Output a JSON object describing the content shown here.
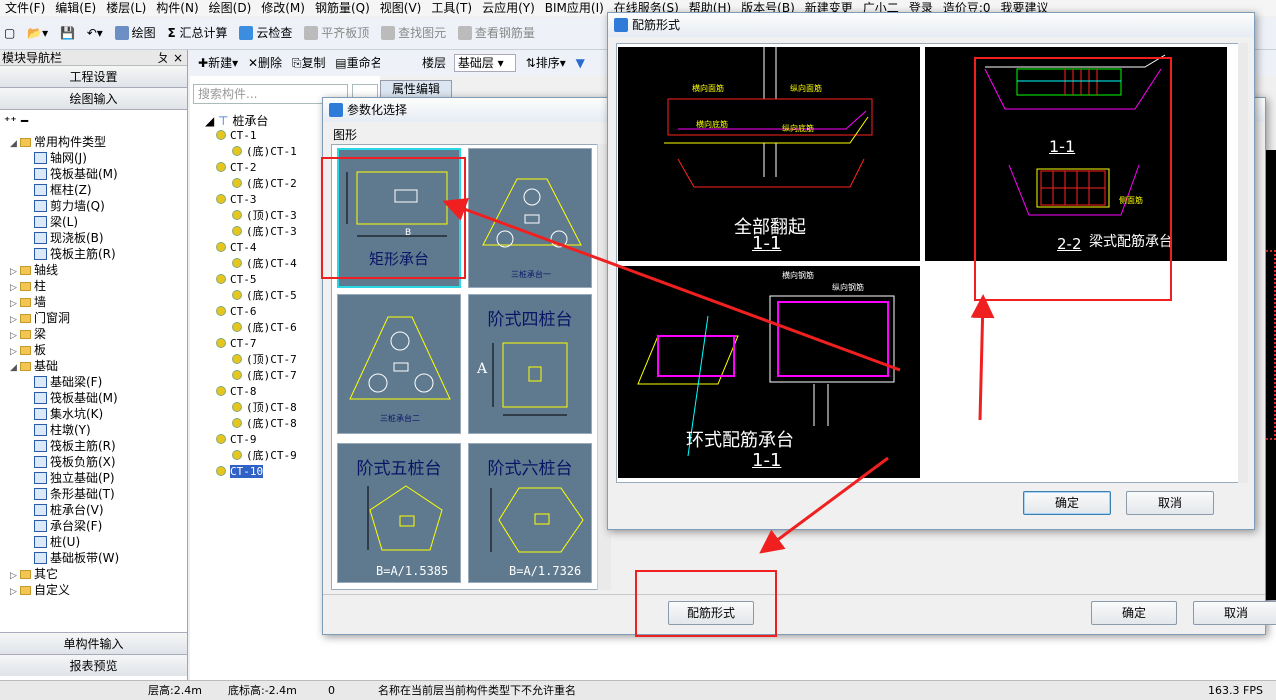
{
  "menu": [
    "文件(F)",
    "编辑(E)",
    "楼层(L)",
    "构件(N)",
    "绘图(D)",
    "修改(M)",
    "钢筋量(Q)",
    "视图(V)",
    "工具(T)",
    "云应用(Y)",
    "BIM应用(I)",
    "在线服务(S)",
    "帮助(H)",
    "版本号(B)",
    "新建变更",
    "广小二",
    "登录",
    "造价豆:0",
    "我要建议"
  ],
  "toolbar": {
    "draw": "绘图",
    "sum": "汇总计算",
    "cloud": "云检查",
    "slab_top": "平齐板顶",
    "find": "查找图元",
    "view_steel": "查看钢筋量"
  },
  "nav": {
    "title": "模块导航栏",
    "pin": "ㄆ ×",
    "project_settings": "工程设置",
    "draw_input": "绘图输入",
    "tree": [
      {
        "label": "常用构件类型",
        "level": 0,
        "type": "folder",
        "open": true
      },
      {
        "label": "轴网(J)",
        "level": 1
      },
      {
        "label": "筏板基础(M)",
        "level": 1
      },
      {
        "label": "框柱(Z)",
        "level": 1
      },
      {
        "label": "剪力墙(Q)",
        "level": 1
      },
      {
        "label": "梁(L)",
        "level": 1
      },
      {
        "label": "现浇板(B)",
        "level": 1
      },
      {
        "label": "筏板主筋(R)",
        "level": 1
      },
      {
        "label": "轴线",
        "level": 0,
        "type": "folder"
      },
      {
        "label": "柱",
        "level": 0,
        "type": "folder"
      },
      {
        "label": "墙",
        "level": 0,
        "type": "folder"
      },
      {
        "label": "门窗洞",
        "level": 0,
        "type": "folder"
      },
      {
        "label": "梁",
        "level": 0,
        "type": "folder"
      },
      {
        "label": "板",
        "level": 0,
        "type": "folder"
      },
      {
        "label": "基础",
        "level": 0,
        "type": "folder",
        "open": true
      },
      {
        "label": "基础梁(F)",
        "level": 1
      },
      {
        "label": "筏板基础(M)",
        "level": 1
      },
      {
        "label": "集水坑(K)",
        "level": 1
      },
      {
        "label": "柱墩(Y)",
        "level": 1
      },
      {
        "label": "筏板主筋(R)",
        "level": 1
      },
      {
        "label": "筏板负筋(X)",
        "level": 1
      },
      {
        "label": "独立基础(P)",
        "level": 1
      },
      {
        "label": "条形基础(T)",
        "level": 1
      },
      {
        "label": "桩承台(V)",
        "level": 1
      },
      {
        "label": "承台梁(F)",
        "level": 1
      },
      {
        "label": "桩(U)",
        "level": 1
      },
      {
        "label": "基础板带(W)",
        "level": 1
      },
      {
        "label": "其它",
        "level": 0,
        "type": "folder"
      },
      {
        "label": "自定义",
        "level": 0,
        "type": "folder"
      }
    ],
    "single_input": "单构件输入",
    "report": "报表预览"
  },
  "mid": {
    "new": "新建",
    "delete": "删除",
    "copy": "复制",
    "rename": "重命名",
    "floor": "楼层",
    "floor_val": "基础层",
    "sort": "排序",
    "search_ph": "搜索构件...",
    "prop_tab": "属性编辑",
    "root": "桩承台",
    "items": [
      {
        "t": "CT-1",
        "l": 0
      },
      {
        "t": "(底)CT-1",
        "l": 1
      },
      {
        "t": "CT-2",
        "l": 0
      },
      {
        "t": "(底)CT-2",
        "l": 1
      },
      {
        "t": "CT-3",
        "l": 0
      },
      {
        "t": "(顶)CT-3",
        "l": 1
      },
      {
        "t": "(底)CT-3",
        "l": 1
      },
      {
        "t": "CT-4",
        "l": 0
      },
      {
        "t": "(底)CT-4",
        "l": 1
      },
      {
        "t": "CT-5",
        "l": 0
      },
      {
        "t": "(底)CT-5",
        "l": 1
      },
      {
        "t": "CT-6",
        "l": 0
      },
      {
        "t": "(底)CT-6",
        "l": 1
      },
      {
        "t": "CT-7",
        "l": 0
      },
      {
        "t": "(顶)CT-7",
        "l": 1
      },
      {
        "t": "(底)CT-7",
        "l": 1
      },
      {
        "t": "CT-8",
        "l": 0
      },
      {
        "t": "(顶)CT-8",
        "l": 1
      },
      {
        "t": "(底)CT-8",
        "l": 1
      },
      {
        "t": "CT-9",
        "l": 0
      },
      {
        "t": "(底)CT-9",
        "l": 1
      },
      {
        "t": "CT-10",
        "l": 0,
        "sel": true
      }
    ]
  },
  "param_dialog": {
    "title": "参数化选择",
    "group": "图形",
    "tiles": [
      {
        "name": "矩形承台",
        "sub": "B"
      },
      {
        "name": "三桩承台一",
        "sub": ""
      },
      {
        "name": "三桩承台二",
        "sub": ""
      },
      {
        "name": "阶式四桩台",
        "sub": "A"
      },
      {
        "name": "阶式五桩台",
        "sub": "B=A/1.5385"
      },
      {
        "name": "阶式六桩台",
        "sub": "B=A/1.7326"
      }
    ],
    "rebar_btn": "配筋形式",
    "ok": "确定",
    "cancel": "取消"
  },
  "rebar_dialog": {
    "title": "配筋形式",
    "panels": [
      {
        "caption": "全部翻起",
        "section": "1-1"
      },
      {
        "caption": "梁式配筋承台",
        "section1": "1-1",
        "section2": "2-2"
      },
      {
        "caption": "环式配筋承台",
        "section": "1-1"
      }
    ],
    "small_labels": [
      "横向面筋",
      "纵向面筋",
      "横向底筋",
      "纵向底筋",
      "横向钢筋",
      "纵向钢筋",
      "侧面筋"
    ],
    "ok": "确定",
    "cancel": "取消"
  },
  "status": {
    "floor_h": "层高:2.4m",
    "base_h": "底标高:-2.4m",
    "zero": "0",
    "msg": "名称在当前层当前构件类型下不允许重名",
    "fps": "163.3 FPS"
  },
  "colors": {
    "annotation_red": "#f02020",
    "tile_bg": "#5f7a8f",
    "cad_bg": "#000000"
  }
}
